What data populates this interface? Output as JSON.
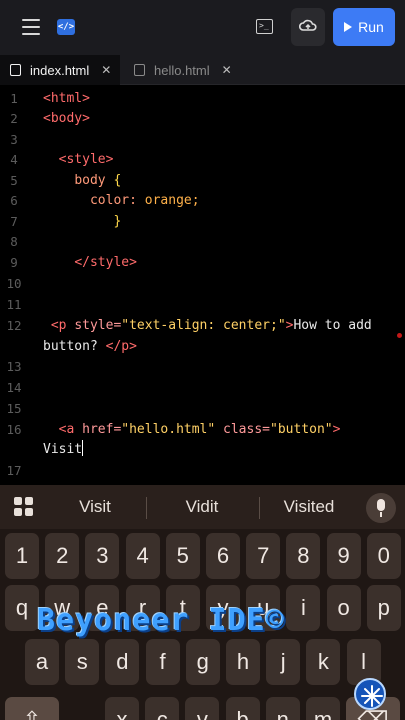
{
  "toolbar": {
    "menu_icon": "hamburger-menu-icon",
    "code_icon": "</>",
    "terminal_icon": ">_",
    "cloud_icon": "cloud-upload-icon",
    "run_label": "Run"
  },
  "tabs": [
    {
      "label": "index.html",
      "close": "✕",
      "active": true
    },
    {
      "label": "hello.html",
      "close": "✕",
      "active": false
    }
  ],
  "editor": {
    "line_numbers": [
      "1",
      "2",
      "3",
      "4",
      "5",
      "6",
      "7",
      "8",
      "9",
      "10",
      "11",
      "12",
      "13",
      "14",
      "15",
      "16",
      "17"
    ]
  },
  "suggestions": [
    "Visit",
    "Vidit",
    "Visited"
  ],
  "keyboard": {
    "row1": [
      "1",
      "2",
      "3",
      "4",
      "5",
      "6",
      "7",
      "8",
      "9",
      "0"
    ],
    "row2": [
      "q",
      "w",
      "e",
      "r",
      "t",
      "y",
      "u",
      "i",
      "o",
      "p"
    ],
    "row3": [
      "a",
      "s",
      "d",
      "f",
      "g",
      "h",
      "j",
      "k",
      "l"
    ],
    "row4_partial": [
      "x",
      "c",
      "v",
      "b",
      "n",
      "m"
    ]
  },
  "watermark": {
    "text": "Beyoneer IDE©"
  },
  "colors": {
    "accent": "#3d7bf5",
    "tag": "#ff6b6b",
    "string": "#ffd166"
  }
}
